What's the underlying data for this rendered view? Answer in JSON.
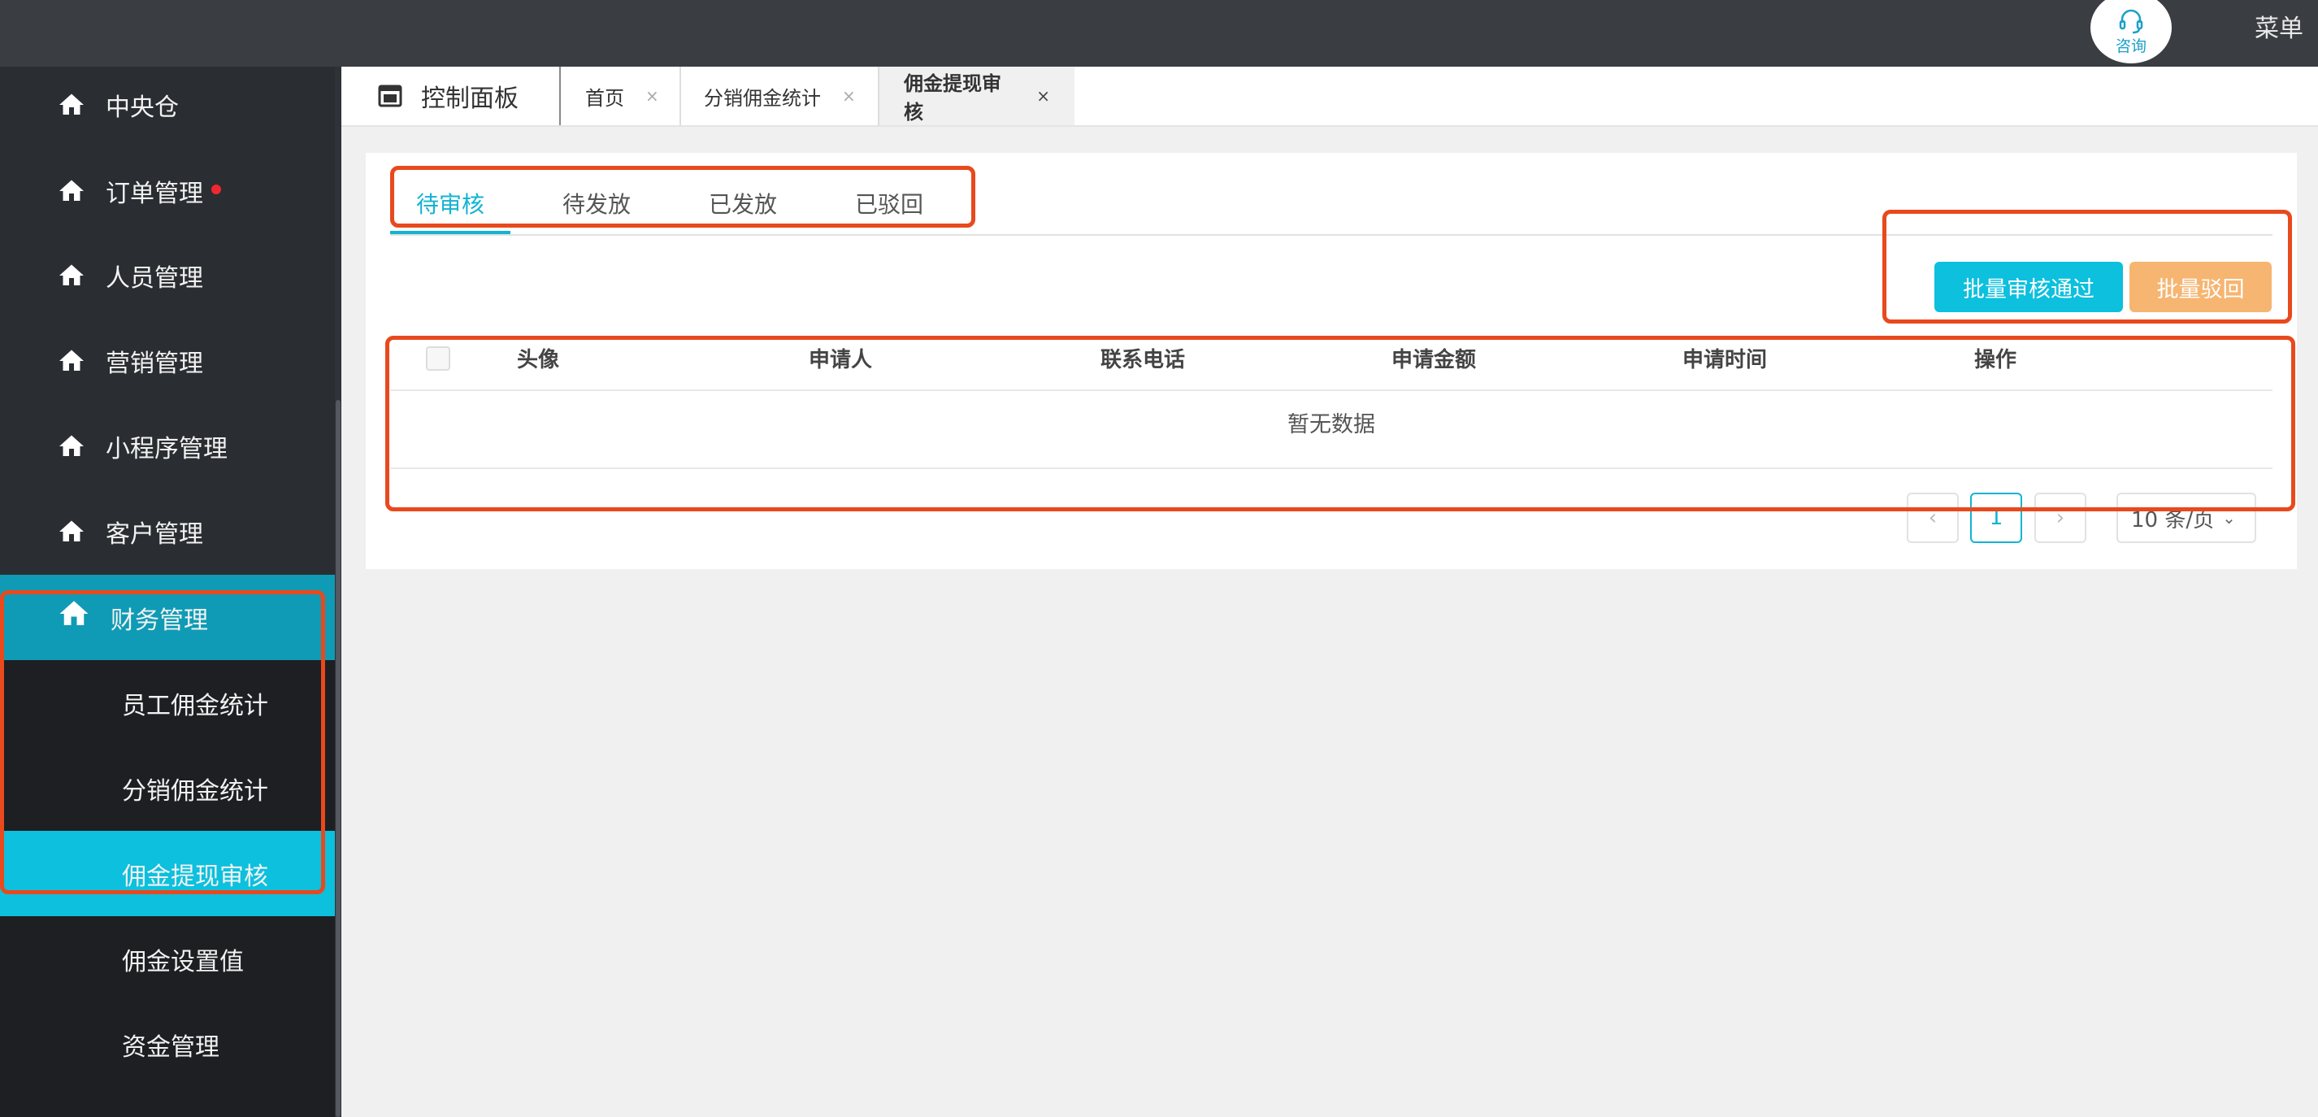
{
  "header": {
    "consult_label": "咨询",
    "menu_label": "菜单"
  },
  "sidebar": {
    "items": [
      {
        "label": "中央仓",
        "icon": "home-icon"
      },
      {
        "label": "订单管理",
        "icon": "home-icon",
        "badge_color": "#f0282d"
      },
      {
        "label": "人员管理",
        "icon": "home-icon"
      },
      {
        "label": "营销管理",
        "icon": "home-icon"
      },
      {
        "label": "小程序管理",
        "icon": "home-icon"
      },
      {
        "label": "客户管理",
        "icon": "home-icon"
      },
      {
        "label": "财务管理",
        "icon": "home-icon",
        "expanded": true
      }
    ],
    "sub_items": [
      {
        "label": "员工佣金统计"
      },
      {
        "label": "分销佣金统计"
      },
      {
        "label": "佣金提现审核",
        "active": true
      },
      {
        "label": "佣金设置值"
      },
      {
        "label": "资金管理"
      }
    ]
  },
  "tabs": {
    "dashboard_label": "控制面板",
    "pages": [
      {
        "label": "首页",
        "close": "×"
      },
      {
        "label": "分销佣金统计",
        "close": "×"
      },
      {
        "label": "佣金提现审核",
        "close": "×",
        "active": true
      }
    ]
  },
  "status_tabs": [
    {
      "label": "待审核",
      "active": true
    },
    {
      "label": "待发放"
    },
    {
      "label": "已发放"
    },
    {
      "label": "已驳回"
    }
  ],
  "actions": {
    "batch_approve": "批量审核通过",
    "batch_reject": "批量驳回"
  },
  "table": {
    "columns": [
      "头像",
      "申请人",
      "联系电话",
      "申请金额",
      "申请时间",
      "操作"
    ],
    "empty_text": "暂无数据"
  },
  "pagination": {
    "prev": "‹",
    "current_page": "1",
    "next": "›",
    "page_size": "10 条/页"
  },
  "colors": {
    "accent": "#12b4d2",
    "sidebar_bg": "#2a2d31",
    "active_group": "#0f9bb5",
    "active_sub": "#0cc0de",
    "reject_btn": "#f6b571",
    "annotation": "#e8491d"
  }
}
